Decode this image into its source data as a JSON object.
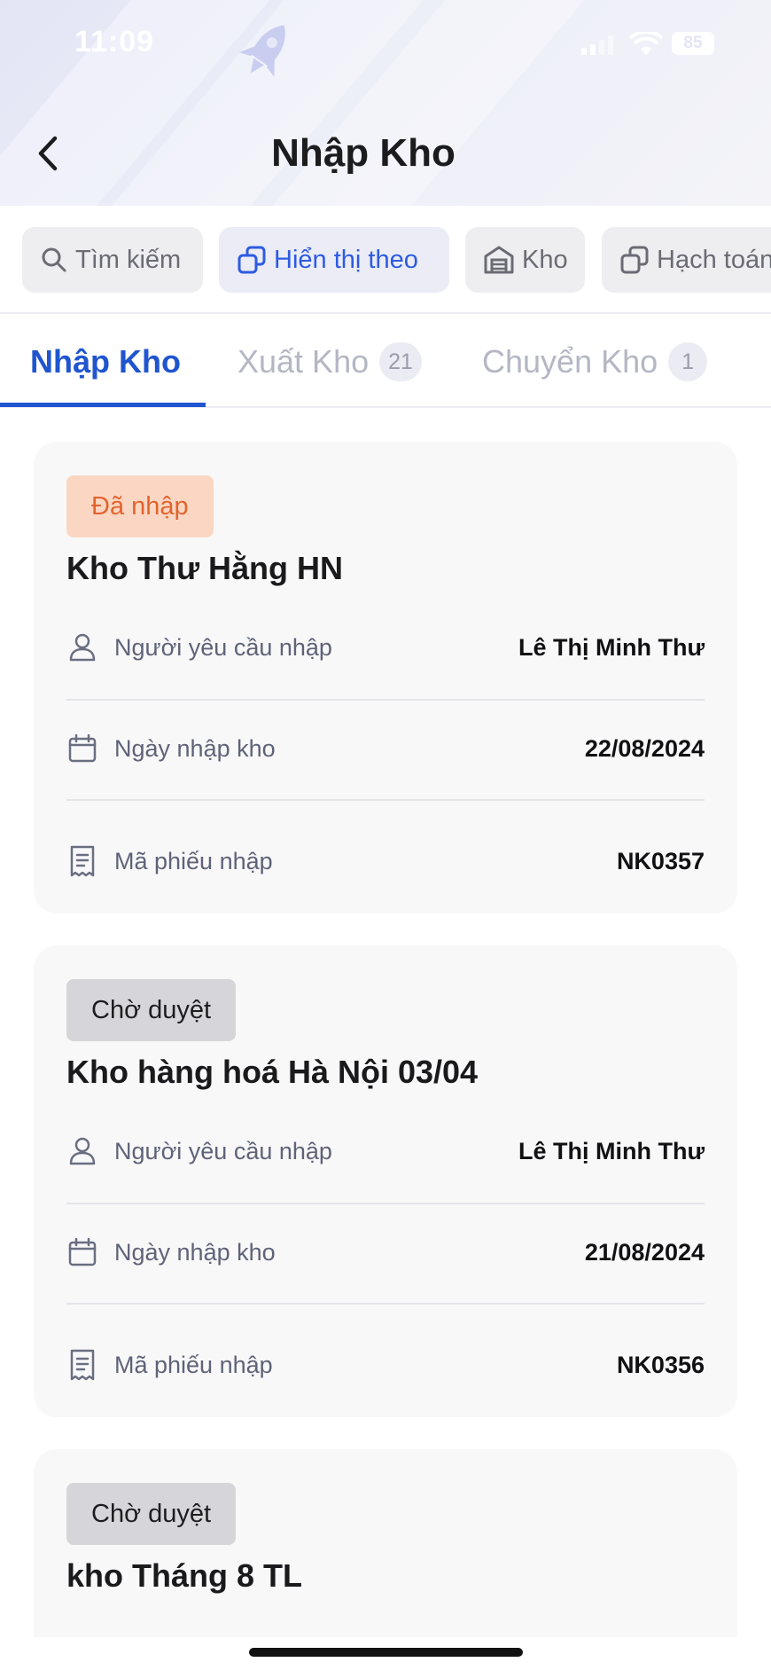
{
  "status_bar": {
    "time": "11:09",
    "battery": "85"
  },
  "header": {
    "title": "Nhập Kho"
  },
  "filters": [
    {
      "label": "Tìm kiếm",
      "icon": "search-icon",
      "active": false
    },
    {
      "label": "Hiển thị theo",
      "icon": "copy-icon",
      "active": true
    },
    {
      "label": "Kho",
      "icon": "warehouse-icon",
      "active": false
    },
    {
      "label": "Hạch toán",
      "icon": "copy-icon",
      "active": false
    }
  ],
  "tabs": [
    {
      "label": "Nhập Kho",
      "count": "",
      "active": true
    },
    {
      "label": "Xuất Kho",
      "count": "21",
      "active": false
    },
    {
      "label": "Chuyển Kho",
      "count": "1",
      "active": false
    }
  ],
  "labels": {
    "requester": "Người yêu cầu nhập",
    "date": "Ngày nhập kho",
    "code": "Mã phiếu nhập"
  },
  "cards": [
    {
      "status": "Đã nhập",
      "title": "Kho Thư Hằng HN",
      "requester": "Lê Thị Minh Thư",
      "date": "22/08/2024",
      "code": "NK0357"
    },
    {
      "status": "Chờ duyệt",
      "title": "Kho hàng hoá Hà Nội 03/04",
      "requester": "Lê Thị Minh Thư",
      "date": "21/08/2024",
      "code": "NK0356"
    },
    {
      "status": "Chờ duyệt",
      "title": "kho Tháng 8 TL"
    }
  ],
  "colors": {
    "accent": "#1f55cf",
    "imported_badge_bg": "#fbd7c3",
    "imported_badge_text": "#e3632d",
    "pending_badge_bg": "#d6d6da"
  }
}
